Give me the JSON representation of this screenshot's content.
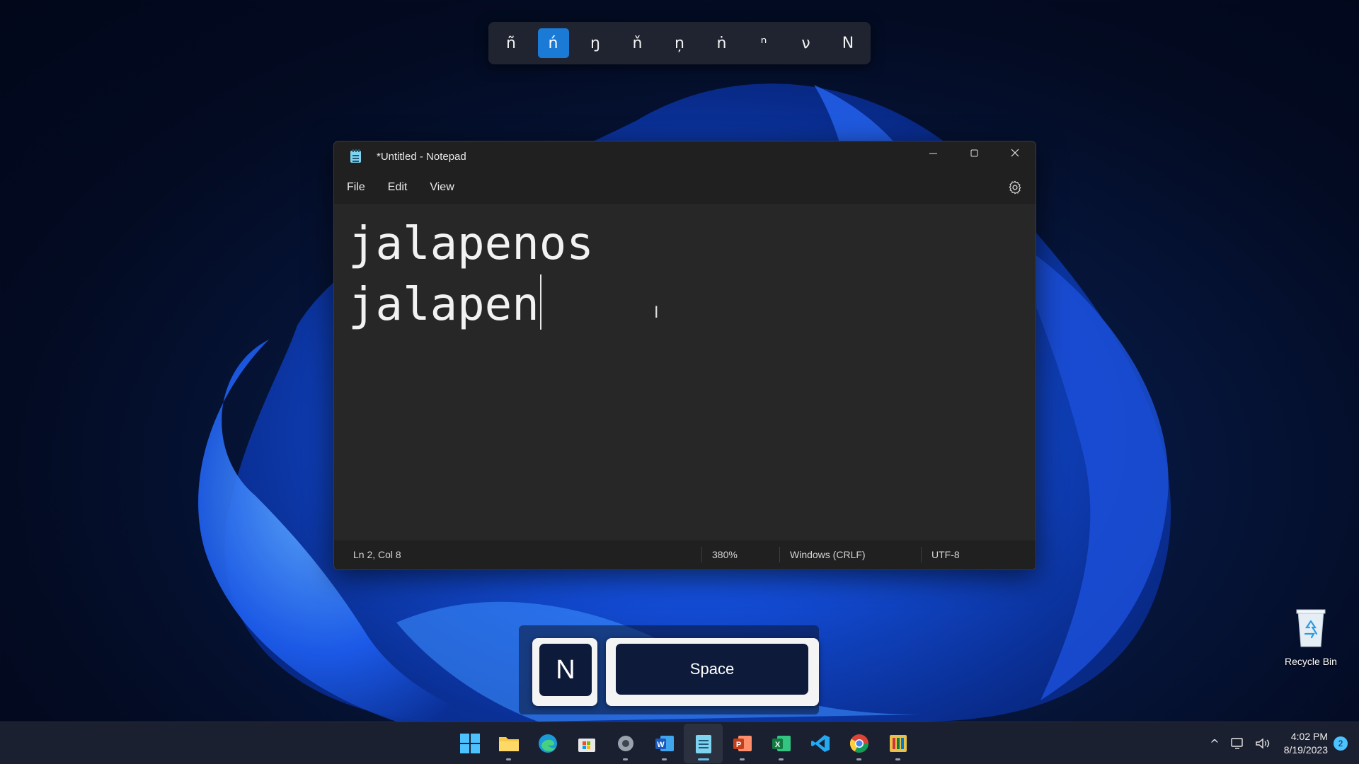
{
  "accent_picker": {
    "characters": [
      "ñ",
      "ń",
      "ŋ",
      "ň",
      "ņ",
      "ṅ",
      "ⁿ",
      "ν",
      "Ν"
    ],
    "selected_index": 1
  },
  "notepad": {
    "title": "*Untitled - Notepad",
    "menu": [
      "File",
      "Edit",
      "View"
    ],
    "lines": [
      "jalapenos",
      "jalapen"
    ],
    "status": {
      "position": "Ln 2, Col 8",
      "zoom": "380%",
      "line_ending": "Windows (CRLF)",
      "encoding": "UTF-8"
    }
  },
  "keystrokes": {
    "key1": "N",
    "key2": "Space"
  },
  "desktop": {
    "recycle_bin_label": "Recycle Bin"
  },
  "taskbar": {
    "pinned": [
      "start-icon",
      "file-explorer-icon",
      "edge-icon",
      "store-icon",
      "settings-icon",
      "word-icon",
      "notepad-icon",
      "powerpoint-icon",
      "excel-icon",
      "vscode-icon",
      "chrome-icon",
      "app-icon"
    ],
    "time": "4:02 PM",
    "date": "8/19/2023",
    "notification_count": "2"
  },
  "colors": {
    "accent": "#1a7ad6",
    "window_bg": "#272727",
    "taskbar_bg": "#1b2030"
  }
}
